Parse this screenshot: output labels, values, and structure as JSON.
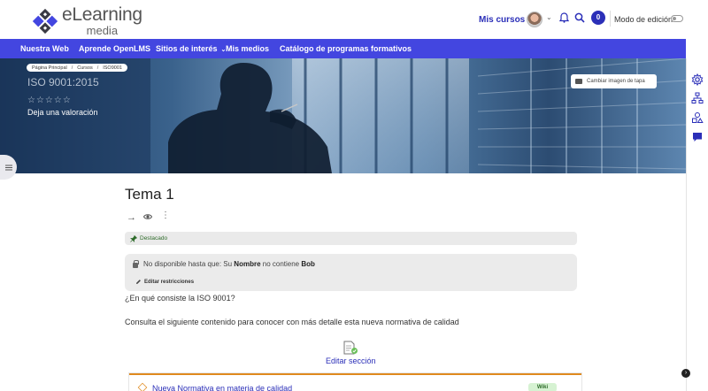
{
  "brand": {
    "logo_main": "eLearning",
    "logo_sub": "media"
  },
  "header": {
    "my_courses": "Mis cursos",
    "message_count": "0",
    "edit_mode_label": "Modo de edición"
  },
  "nav": {
    "items": [
      {
        "label": "Nuestra Web"
      },
      {
        "label": "Aprende OpenLMS"
      },
      {
        "label": "Sitios de interés"
      },
      {
        "label": "Mis medios"
      },
      {
        "label": "Catálogo de programas formativos"
      }
    ]
  },
  "hero": {
    "breadcrumb": [
      "Página Principal",
      "Cursos",
      "ISO9001"
    ],
    "breadcrumb_sep": "/",
    "course_title": "ISO 9001:2015",
    "stars": "☆☆☆☆☆",
    "rating_value": 0,
    "rating_max": 5,
    "rate_link": "Deja una valoración",
    "cover_button": "Cambiar imagen de tapa"
  },
  "section": {
    "title": "Tema 1",
    "featured_label": "Destacado",
    "restriction": {
      "prefix": "No disponible hasta que: Su ",
      "field": "Nombre",
      "middle": " no contiene ",
      "value": "Bob",
      "edit_label": "Editar restricciones"
    },
    "paragraph1": "¿En qué consiste la ISO 9001?",
    "paragraph2": "Consulta el siguiente contenido para conocer con más detalle esta nueva normativa de calidad",
    "edit_section_label": "Editar sección",
    "activity_title": "Nueva Normativa en materia de calidad",
    "activity_badge": "Wiki"
  },
  "colors": {
    "accent": "#4346e0",
    "link": "#2b2fb8",
    "activity_border": "#e08a1e"
  }
}
